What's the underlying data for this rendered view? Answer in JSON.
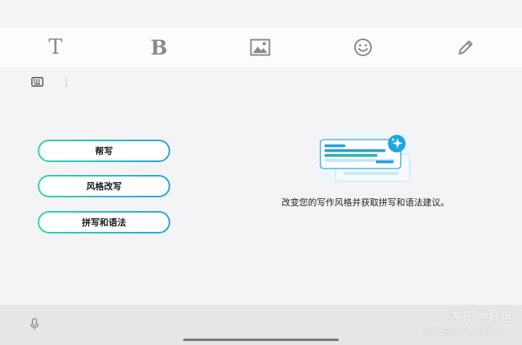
{
  "toolbar": {
    "items": [
      {
        "name": "text-format",
        "icon": "text-T-icon",
        "glyph": "T"
      },
      {
        "name": "bold",
        "icon": "bold-B-icon",
        "glyph": "B"
      },
      {
        "name": "insert-image",
        "icon": "image-icon"
      },
      {
        "name": "emoji",
        "icon": "smiley-icon"
      },
      {
        "name": "handwriting",
        "icon": "pencil-icon"
      }
    ]
  },
  "writing_assist": {
    "buttons": [
      {
        "label": "帮写"
      },
      {
        "label": "风格改写"
      },
      {
        "label": "拼写和语法"
      }
    ],
    "description": "改变您的写作风格并获取拼写和语法建议。"
  },
  "watermark": {
    "brand": "盖乐世社区",
    "user": "@好喜欢Note系列"
  },
  "colors": {
    "gradient_start": "#2fd6a6",
    "gradient_end": "#2aa3d8",
    "sparkle_badge": "#1fa6e0"
  }
}
